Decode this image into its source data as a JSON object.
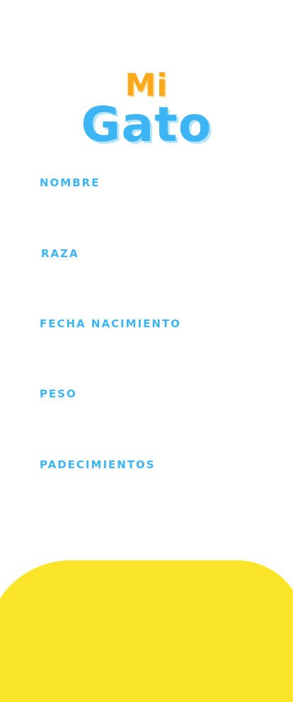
{
  "logo": {
    "line1": "Mi",
    "line2": "Gato"
  },
  "form": {
    "fields": [
      {
        "label": "NOMBRE",
        "value": ""
      },
      {
        "label": "RAZA",
        "value": ""
      },
      {
        "label": "FECHA NACIMIENTO",
        "value": ""
      },
      {
        "label": "PESO",
        "value": ""
      },
      {
        "label": "PADECIMIENTOS",
        "value": ""
      }
    ]
  },
  "colors": {
    "accent_blue": "#3db5f4",
    "accent_orange": "#fba91a",
    "footer_yellow": "#fbe52a",
    "background": "#ffffff"
  }
}
